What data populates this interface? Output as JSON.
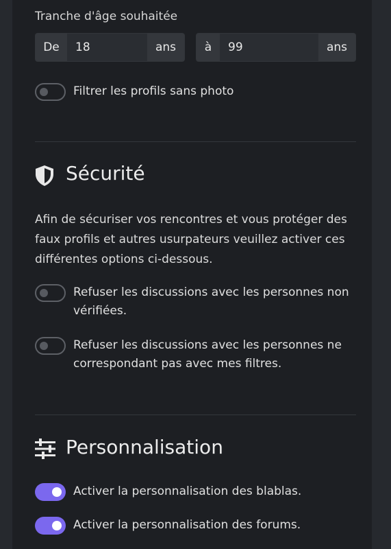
{
  "age_range": {
    "label": "Tranche d'âge souhaitée",
    "from_prefix": "De",
    "from_value": "18",
    "from_suffix": "ans",
    "to_prefix": "à",
    "to_value": "99",
    "to_suffix": "ans"
  },
  "filters": {
    "no_photo": {
      "label": "Filtrer les profils sans photo",
      "on": false
    }
  },
  "security": {
    "title": "Sécurité",
    "icon": "shield-icon",
    "description": "Afin de sécuriser vos rencontres et vous protéger des faux profils et autres usurpateurs veuillez activer ces différentes options ci-dessous.",
    "options": [
      {
        "label": "Refuser les discussions avec les personnes non vérifiées.",
        "on": false
      },
      {
        "label": "Refuser les discussions avec les personnes ne correspondant pas avec mes filtres.",
        "on": false
      }
    ]
  },
  "personalisation": {
    "title": "Personnalisation",
    "icon": "sliders-icon",
    "options": [
      {
        "label": "Activer la personnalisation des blablas.",
        "on": true
      },
      {
        "label": "Activer la personnalisation des forums.",
        "on": true
      }
    ]
  },
  "colors": {
    "accent": "#7b68ee",
    "background": "#1d1f23"
  }
}
